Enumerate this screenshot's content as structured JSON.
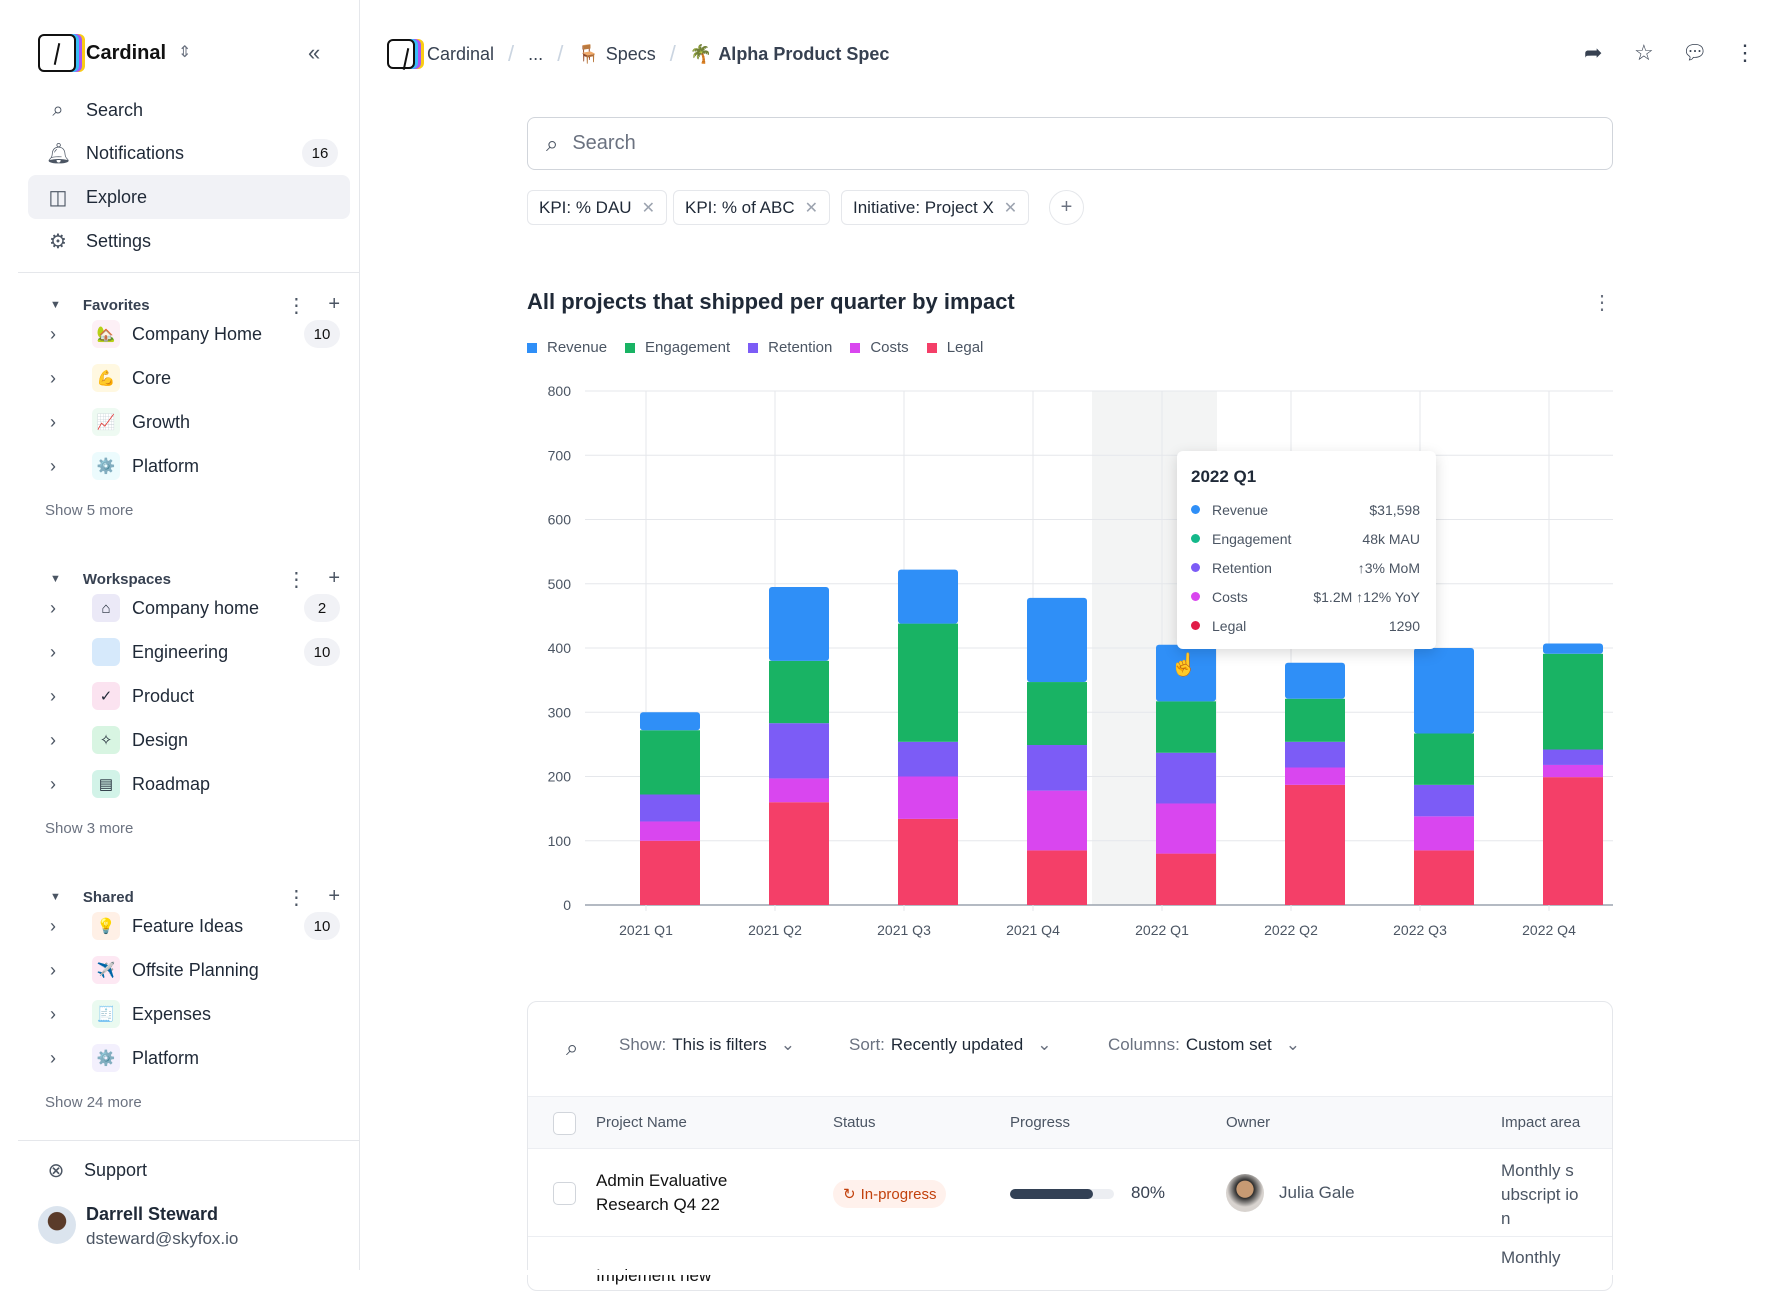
{
  "sidebar": {
    "workspace": "Cardinal",
    "nav": [
      {
        "label": "Search",
        "icon": "search-icon"
      },
      {
        "label": "Notifications",
        "icon": "bell-icon",
        "badge": "16"
      },
      {
        "label": "Explore",
        "icon": "chart-icon",
        "active": true
      },
      {
        "label": "Settings",
        "icon": "gear-icon"
      }
    ],
    "sections": [
      {
        "title": "Favorites",
        "items": [
          {
            "label": "Company Home",
            "emoji": "🏡",
            "badge": "10"
          },
          {
            "label": "Core",
            "emoji": "💪"
          },
          {
            "label": "Growth",
            "emoji": "📈"
          },
          {
            "label": "Platform",
            "emoji": "⚙️"
          }
        ],
        "more": "Show 5 more"
      },
      {
        "title": "Workspaces",
        "items": [
          {
            "label": "Company home",
            "emoji": "⌂",
            "badge": "2"
          },
          {
            "label": "Engineering",
            "emoji": "</>",
            "badge": "10"
          },
          {
            "label": "Product",
            "emoji": "✓"
          },
          {
            "label": "Design",
            "emoji": "✧"
          },
          {
            "label": "Roadmap",
            "emoji": "▤"
          }
        ],
        "more": "Show 3 more"
      },
      {
        "title": "Shared",
        "items": [
          {
            "label": "Feature Ideas",
            "emoji": "💡",
            "badge": "10"
          },
          {
            "label": "Offsite Planning",
            "emoji": "✈️"
          },
          {
            "label": "Expenses",
            "emoji": "🧾"
          },
          {
            "label": "Platform",
            "emoji": "⚙️"
          }
        ],
        "more": "Show 24 more"
      }
    ],
    "support": "Support",
    "user": {
      "name": "Darrell Steward",
      "email": "dsteward@skyfox.io"
    }
  },
  "breadcrumb": [
    {
      "label": "Cardinal"
    },
    {
      "label": "..."
    },
    {
      "label": "Specs",
      "emoji": "🪑"
    },
    {
      "label": "Alpha Product Spec",
      "emoji": "🌴"
    }
  ],
  "search": {
    "placeholder": "Search"
  },
  "filters": [
    "KPI: % DAU",
    "KPI: % of ABC",
    "Initiative: Project X"
  ],
  "chart_data": {
    "type": "bar",
    "stacked": true,
    "title": "All projects that shipped per quarter by impact",
    "categories": [
      "2021 Q1",
      "2021 Q2",
      "2021 Q3",
      "2021 Q4",
      "2022 Q1",
      "2022 Q2",
      "2022 Q3",
      "2022 Q4"
    ],
    "ylim": [
      0,
      800
    ],
    "yticks": [
      0,
      100,
      200,
      300,
      400,
      500,
      600,
      700,
      800
    ],
    "grid": true,
    "legend": "top-left",
    "series": [
      {
        "name": "Legal",
        "color": "#f43f68",
        "values": [
          100,
          160,
          134,
          85,
          80,
          187,
          85,
          199
        ]
      },
      {
        "name": "Costs",
        "color": "#d946ef",
        "values": [
          30,
          37,
          66,
          93,
          78,
          27,
          53,
          19
        ]
      },
      {
        "name": "Retention",
        "color": "#7c5cf6",
        "values": [
          42,
          86,
          54,
          71,
          79,
          40,
          49,
          24
        ]
      },
      {
        "name": "Engagement",
        "color": "#19b364",
        "values": [
          100,
          97,
          184,
          98,
          80,
          67,
          80,
          149
        ]
      },
      {
        "name": "Revenue",
        "color": "#2f8ff7",
        "values": [
          28,
          115,
          84,
          131,
          88,
          56,
          133,
          16
        ]
      }
    ],
    "legend_order": [
      "Revenue",
      "Engagement",
      "Retention",
      "Costs",
      "Legal"
    ],
    "highlighted": "2022 Q1",
    "tooltip": {
      "title": "2022 Q1",
      "rows": [
        {
          "name": "Revenue",
          "color": "#2f8ff7",
          "value": "$31,598"
        },
        {
          "name": "Engagement",
          "color": "#14b88a",
          "value": "48k MAU"
        },
        {
          "name": "Retention",
          "color": "#7c5cf6",
          "value": "↑3% MoM"
        },
        {
          "name": "Costs",
          "color": "#d946ef",
          "value": "$1.2M ↑12% YoY"
        },
        {
          "name": "Legal",
          "color": "#e11d48",
          "value": "1290"
        }
      ]
    }
  },
  "table": {
    "toolbar": {
      "show_label": "Show:",
      "show_value": "This is filters",
      "sort_label": "Sort:",
      "sort_value": "Recently updated",
      "columns_label": "Columns:",
      "columns_value": "Custom set"
    },
    "columns": [
      "Project Name",
      "Status",
      "Progress",
      "Owner",
      "Impact area"
    ],
    "rows": [
      {
        "name": "Admin Evaluative Research Q4 22",
        "status": "In-progress",
        "progress": 80,
        "progress_label": "80%",
        "owner": "Julia Gale",
        "impact": "Monthly subscript ion"
      },
      {
        "name": "Implement new",
        "impact": "Monthly"
      }
    ]
  }
}
